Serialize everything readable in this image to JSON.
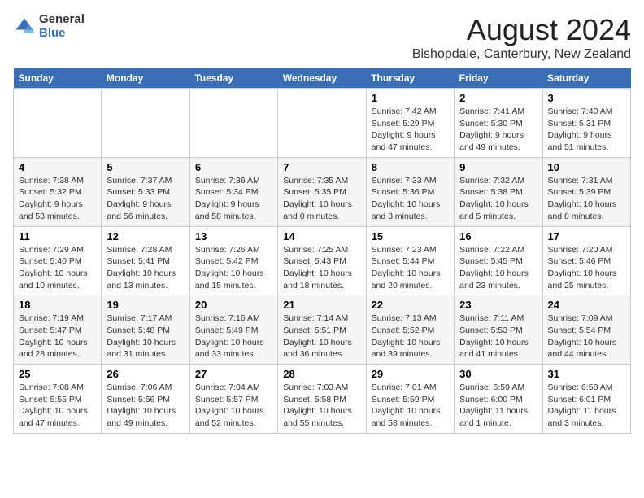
{
  "header": {
    "logo_general": "General",
    "logo_blue": "Blue",
    "title": "August 2024",
    "subtitle": "Bishopdale, Canterbury, New Zealand"
  },
  "weekdays": [
    "Sunday",
    "Monday",
    "Tuesday",
    "Wednesday",
    "Thursday",
    "Friday",
    "Saturday"
  ],
  "weeks": [
    [
      {
        "day": "",
        "info": ""
      },
      {
        "day": "",
        "info": ""
      },
      {
        "day": "",
        "info": ""
      },
      {
        "day": "",
        "info": ""
      },
      {
        "day": "1",
        "info": "Sunrise: 7:42 AM\nSunset: 5:29 PM\nDaylight: 9 hours\nand 47 minutes."
      },
      {
        "day": "2",
        "info": "Sunrise: 7:41 AM\nSunset: 5:30 PM\nDaylight: 9 hours\nand 49 minutes."
      },
      {
        "day": "3",
        "info": "Sunrise: 7:40 AM\nSunset: 5:31 PM\nDaylight: 9 hours\nand 51 minutes."
      }
    ],
    [
      {
        "day": "4",
        "info": "Sunrise: 7:38 AM\nSunset: 5:32 PM\nDaylight: 9 hours\nand 53 minutes."
      },
      {
        "day": "5",
        "info": "Sunrise: 7:37 AM\nSunset: 5:33 PM\nDaylight: 9 hours\nand 56 minutes."
      },
      {
        "day": "6",
        "info": "Sunrise: 7:36 AM\nSunset: 5:34 PM\nDaylight: 9 hours\nand 58 minutes."
      },
      {
        "day": "7",
        "info": "Sunrise: 7:35 AM\nSunset: 5:35 PM\nDaylight: 10 hours\nand 0 minutes."
      },
      {
        "day": "8",
        "info": "Sunrise: 7:33 AM\nSunset: 5:36 PM\nDaylight: 10 hours\nand 3 minutes."
      },
      {
        "day": "9",
        "info": "Sunrise: 7:32 AM\nSunset: 5:38 PM\nDaylight: 10 hours\nand 5 minutes."
      },
      {
        "day": "10",
        "info": "Sunrise: 7:31 AM\nSunset: 5:39 PM\nDaylight: 10 hours\nand 8 minutes."
      }
    ],
    [
      {
        "day": "11",
        "info": "Sunrise: 7:29 AM\nSunset: 5:40 PM\nDaylight: 10 hours\nand 10 minutes."
      },
      {
        "day": "12",
        "info": "Sunrise: 7:28 AM\nSunset: 5:41 PM\nDaylight: 10 hours\nand 13 minutes."
      },
      {
        "day": "13",
        "info": "Sunrise: 7:26 AM\nSunset: 5:42 PM\nDaylight: 10 hours\nand 15 minutes."
      },
      {
        "day": "14",
        "info": "Sunrise: 7:25 AM\nSunset: 5:43 PM\nDaylight: 10 hours\nand 18 minutes."
      },
      {
        "day": "15",
        "info": "Sunrise: 7:23 AM\nSunset: 5:44 PM\nDaylight: 10 hours\nand 20 minutes."
      },
      {
        "day": "16",
        "info": "Sunrise: 7:22 AM\nSunset: 5:45 PM\nDaylight: 10 hours\nand 23 minutes."
      },
      {
        "day": "17",
        "info": "Sunrise: 7:20 AM\nSunset: 5:46 PM\nDaylight: 10 hours\nand 25 minutes."
      }
    ],
    [
      {
        "day": "18",
        "info": "Sunrise: 7:19 AM\nSunset: 5:47 PM\nDaylight: 10 hours\nand 28 minutes."
      },
      {
        "day": "19",
        "info": "Sunrise: 7:17 AM\nSunset: 5:48 PM\nDaylight: 10 hours\nand 31 minutes."
      },
      {
        "day": "20",
        "info": "Sunrise: 7:16 AM\nSunset: 5:49 PM\nDaylight: 10 hours\nand 33 minutes."
      },
      {
        "day": "21",
        "info": "Sunrise: 7:14 AM\nSunset: 5:51 PM\nDaylight: 10 hours\nand 36 minutes."
      },
      {
        "day": "22",
        "info": "Sunrise: 7:13 AM\nSunset: 5:52 PM\nDaylight: 10 hours\nand 39 minutes."
      },
      {
        "day": "23",
        "info": "Sunrise: 7:11 AM\nSunset: 5:53 PM\nDaylight: 10 hours\nand 41 minutes."
      },
      {
        "day": "24",
        "info": "Sunrise: 7:09 AM\nSunset: 5:54 PM\nDaylight: 10 hours\nand 44 minutes."
      }
    ],
    [
      {
        "day": "25",
        "info": "Sunrise: 7:08 AM\nSunset: 5:55 PM\nDaylight: 10 hours\nand 47 minutes."
      },
      {
        "day": "26",
        "info": "Sunrise: 7:06 AM\nSunset: 5:56 PM\nDaylight: 10 hours\nand 49 minutes."
      },
      {
        "day": "27",
        "info": "Sunrise: 7:04 AM\nSunset: 5:57 PM\nDaylight: 10 hours\nand 52 minutes."
      },
      {
        "day": "28",
        "info": "Sunrise: 7:03 AM\nSunset: 5:58 PM\nDaylight: 10 hours\nand 55 minutes."
      },
      {
        "day": "29",
        "info": "Sunrise: 7:01 AM\nSunset: 5:59 PM\nDaylight: 10 hours\nand 58 minutes."
      },
      {
        "day": "30",
        "info": "Sunrise: 6:59 AM\nSunset: 6:00 PM\nDaylight: 11 hours\nand 1 minute."
      },
      {
        "day": "31",
        "info": "Sunrise: 6:58 AM\nSunset: 6:01 PM\nDaylight: 11 hours\nand 3 minutes."
      }
    ]
  ]
}
